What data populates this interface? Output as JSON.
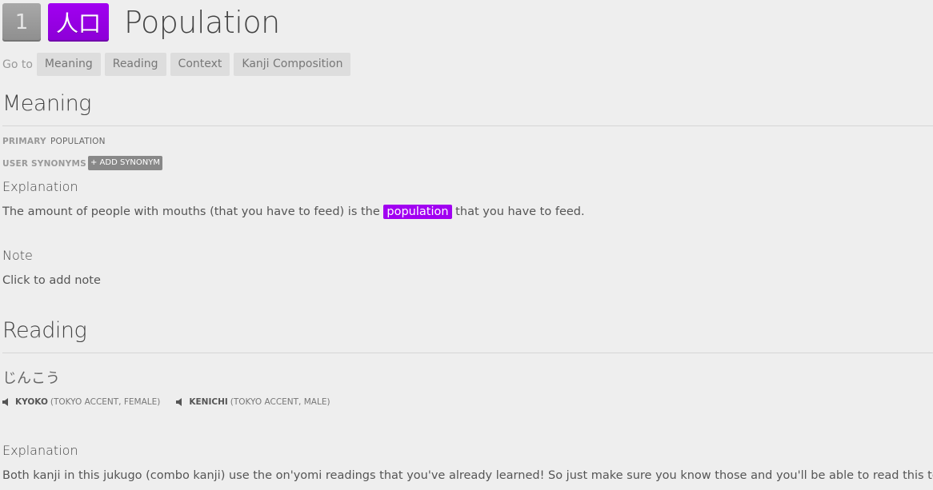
{
  "header": {
    "level": "1",
    "kanji": "人口",
    "title": "Population"
  },
  "goto": {
    "label": "Go to",
    "links": [
      "Meaning",
      "Reading",
      "Context",
      "Kanji Composition"
    ]
  },
  "meaning": {
    "heading": "Meaning",
    "primary_label": "PRIMARY",
    "primary_value": "POPULATION",
    "synonyms_label": "USER SYNONYMS",
    "add_synonym": "+ ADD SYNONYM",
    "explanation_heading": "Explanation",
    "explanation_before": "The amount of people with mouths (that you have to feed) is the ",
    "explanation_highlight": "population",
    "explanation_after": " that you have to feed.",
    "note_heading": "Note",
    "note_placeholder": "Click to add note"
  },
  "reading": {
    "heading": "Reading",
    "kana": "じんこう",
    "voices": [
      {
        "name": "KYOKO",
        "desc": "(TOKYO ACCENT, FEMALE)",
        "icon": "speaker-icon"
      },
      {
        "name": "KENICHI",
        "desc": "(TOKYO ACCENT, MALE)",
        "icon": "speaker-icon"
      }
    ],
    "explanation_heading": "Explanation",
    "explanation": "Both kanji in this jukugo (combo kanji) use the on'yomi readings that you've already learned! So just make sure you know those and you'll be able to read this too."
  },
  "colors": {
    "vocab_purple": "#a100f1",
    "background": "#eeeeee",
    "level_gray": "#9a9a9a"
  }
}
